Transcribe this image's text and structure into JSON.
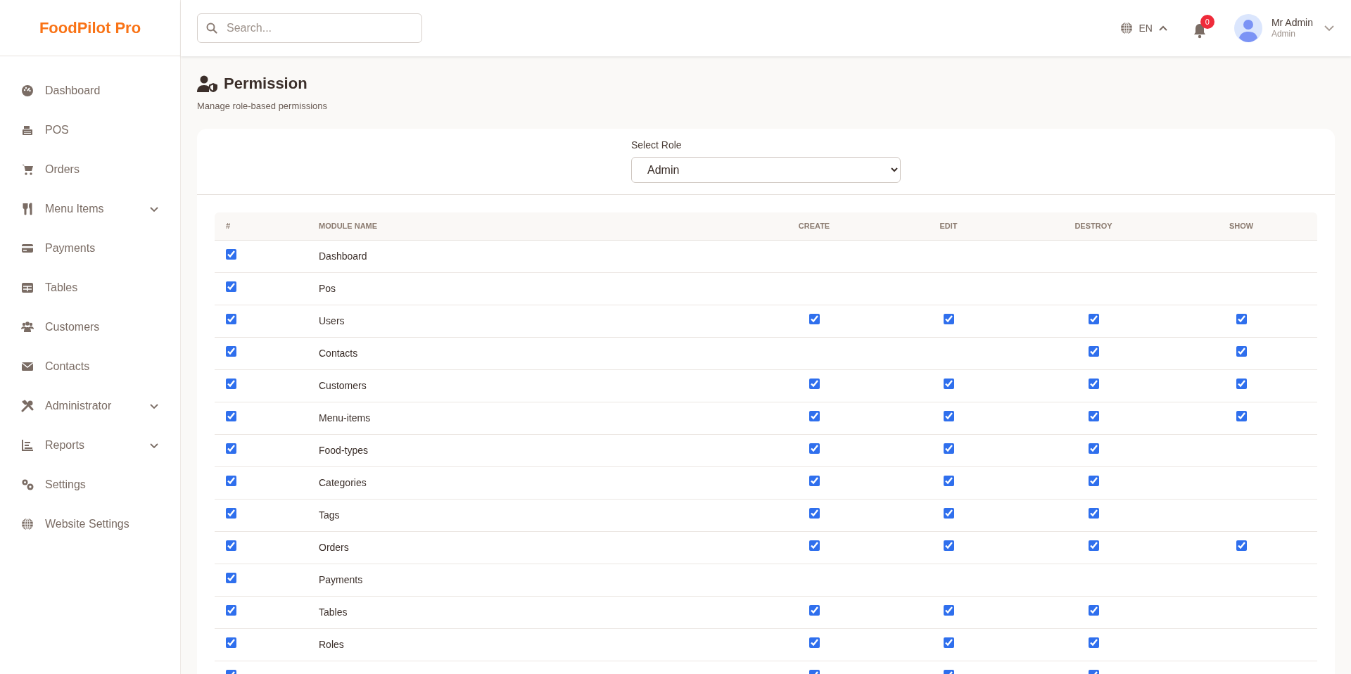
{
  "logo": "FoodPilot Pro",
  "sidebar": {
    "items": [
      {
        "label": "Dashboard",
        "expandable": false
      },
      {
        "label": "POS",
        "expandable": false
      },
      {
        "label": "Orders",
        "expandable": false
      },
      {
        "label": "Menu Items",
        "expandable": true
      },
      {
        "label": "Payments",
        "expandable": false
      },
      {
        "label": "Tables",
        "expandable": false
      },
      {
        "label": "Customers",
        "expandable": false
      },
      {
        "label": "Contacts",
        "expandable": false
      },
      {
        "label": "Administrator",
        "expandable": true
      },
      {
        "label": "Reports",
        "expandable": true
      },
      {
        "label": "Settings",
        "expandable": false
      },
      {
        "label": "Website Settings",
        "expandable": false
      }
    ]
  },
  "header": {
    "search": {
      "placeholder": "Search..."
    },
    "language": "EN",
    "notifications": "0",
    "user": {
      "name": "Mr Admin",
      "role": "Admin"
    }
  },
  "page": {
    "title": "Permission",
    "subtitle": "Manage role-based permissions"
  },
  "role_select": {
    "label": "Select Role",
    "value": "Admin"
  },
  "table": {
    "columns": [
      "#",
      "MODULE NAME",
      "CREATE",
      "EDIT",
      "DESTROY",
      "SHOW"
    ],
    "rows": [
      {
        "checked": true,
        "module": "Dashboard"
      },
      {
        "checked": true,
        "module": "Pos"
      },
      {
        "checked": true,
        "module": "Users",
        "create": true,
        "edit": true,
        "destroy": true,
        "show": true
      },
      {
        "checked": true,
        "module": "Contacts",
        "destroy": true,
        "show": true
      },
      {
        "checked": true,
        "module": "Customers",
        "create": true,
        "edit": true,
        "destroy": true,
        "show": true
      },
      {
        "checked": true,
        "module": "Menu-items",
        "create": true,
        "edit": true,
        "destroy": true,
        "show": true
      },
      {
        "checked": true,
        "module": "Food-types",
        "create": true,
        "edit": true,
        "destroy": true
      },
      {
        "checked": true,
        "module": "Categories",
        "create": true,
        "edit": true,
        "destroy": true
      },
      {
        "checked": true,
        "module": "Tags",
        "create": true,
        "edit": true,
        "destroy": true
      },
      {
        "checked": true,
        "module": "Orders",
        "create": true,
        "edit": true,
        "destroy": true,
        "show": true
      },
      {
        "checked": true,
        "module": "Payments"
      },
      {
        "checked": true,
        "module": "Tables",
        "create": true,
        "edit": true,
        "destroy": true
      },
      {
        "checked": true,
        "module": "Roles",
        "create": true,
        "edit": true,
        "destroy": true
      },
      {
        "checked": true,
        "create": true,
        "edit": true,
        "destroy": true
      }
    ]
  }
}
